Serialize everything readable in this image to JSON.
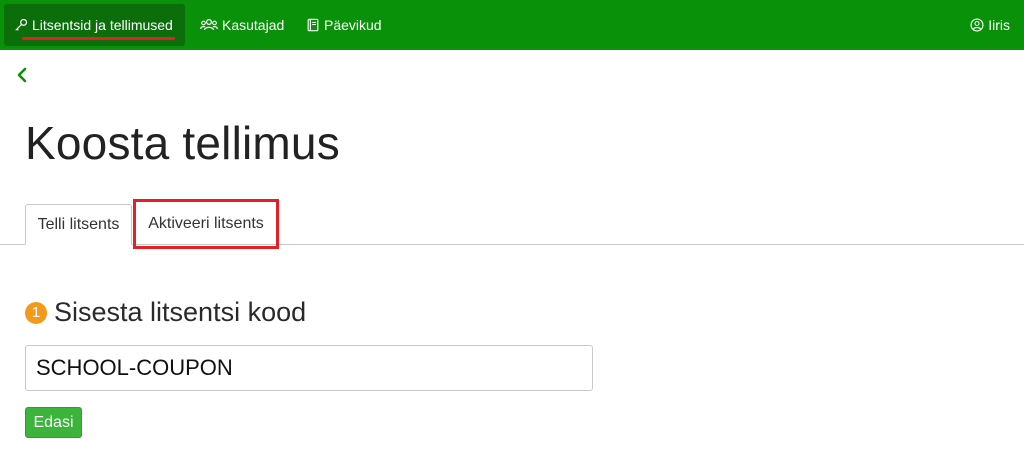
{
  "nav": {
    "licenses_label": "Litsentsid ja tellimused",
    "users_label": "Kasutajad",
    "diaries_label": "Päevikud",
    "user_label": "Iiris"
  },
  "page": {
    "title": "Koosta tellimus"
  },
  "tabs": [
    {
      "label": "Telli litsents",
      "active": true
    },
    {
      "label": "Aktiveeri litsents",
      "active": false
    }
  ],
  "step": {
    "number": "1",
    "title": "Sisesta litsentsi kood"
  },
  "form": {
    "code_value": "SCHOOL-COUPON",
    "next_label": "Edasi"
  },
  "colors": {
    "nav_bg": "#099109",
    "nav_active": "#0b6e0b",
    "highlight": "#e32026",
    "step_badge": "#f39a1a",
    "button": "#3cb43c"
  },
  "icons": {
    "licenses": "key-icon",
    "users": "users-icon",
    "diaries": "book-icon",
    "user": "user-circle-icon",
    "back": "chevron-left-icon"
  }
}
